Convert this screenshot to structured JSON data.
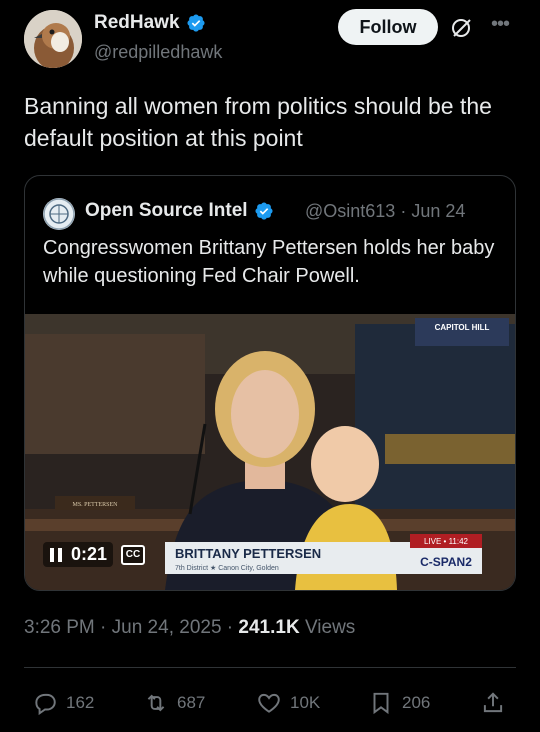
{
  "author": {
    "display_name": "RedHawk",
    "handle": "@redpilledhawk",
    "verified": true
  },
  "follow_label": "Follow",
  "post_text": "Banning all women from politics should be the default position at this point",
  "quote": {
    "display_name": "Open Source Intel",
    "handle": "@Osint613",
    "date": "Jun 24",
    "meta": "@Osint613 · Jun 24",
    "text": "Congresswomen Brittany Pettersen holds her baby while questioning Fed Chair Powell.",
    "video": {
      "time": "0:21",
      "cc_label": "CC",
      "chyron_name": "BRITTANY PETTERSEN",
      "chyron_sub": "7th District ★ Canon City, Golden",
      "network": "C-SPAN2",
      "live_label": "LIVE • 11:42",
      "corner_label": "CAPITOL HILL",
      "nameplate": "MS. PETTERSEN"
    }
  },
  "timestamp": "3:26 PM · Jun 24, 2025 ·",
  "views_count": "241.1K",
  "views_label": "Views",
  "actions": {
    "replies": "162",
    "reposts": "687",
    "likes": "10K",
    "bookmarks": "206"
  },
  "colors": {
    "background": "#000000",
    "text_primary": "#e7e9ea",
    "text_secondary": "#71767b",
    "verified_blue": "#1d9bf0",
    "border": "#2f3336"
  }
}
